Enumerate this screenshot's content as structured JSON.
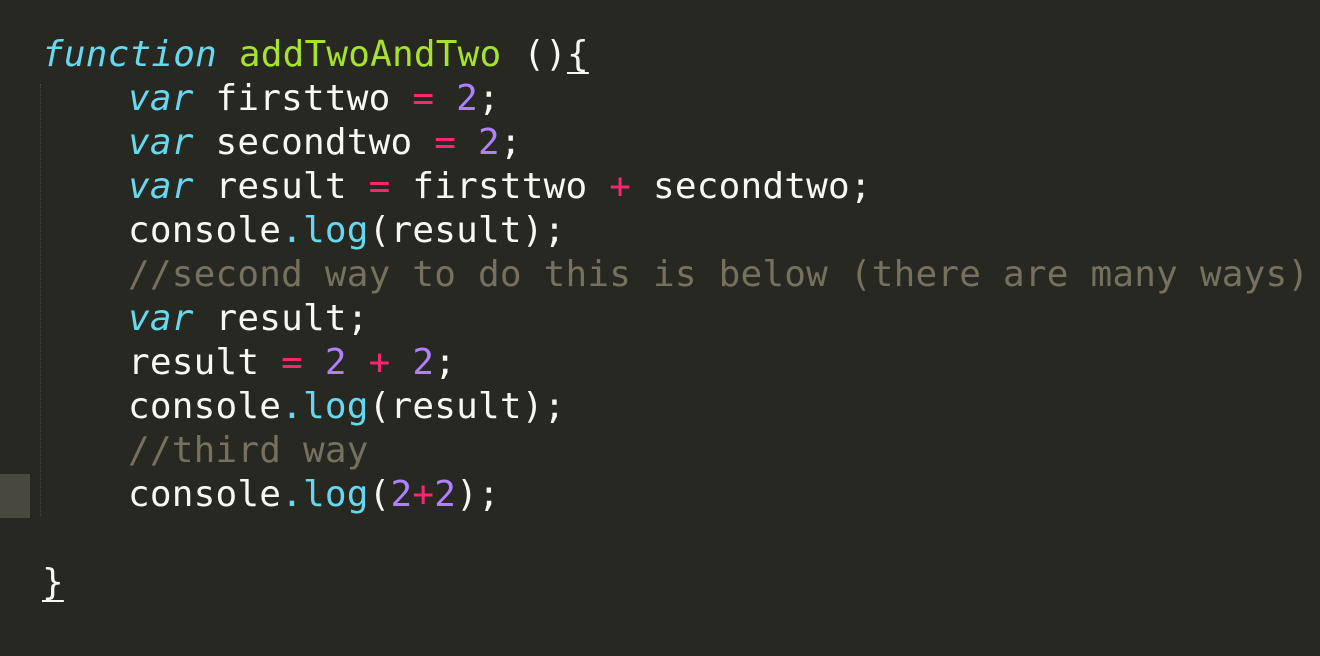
{
  "code": {
    "l1": {
      "keyword": "function",
      "name": "addTwoAndTwo",
      "paren": "()",
      "brace": "{"
    },
    "l2": {
      "kw": "var",
      "ident": "firsttwo",
      "op": "=",
      "num": "2",
      "end": ";"
    },
    "l3": {
      "kw": "var",
      "ident": "secondtwo",
      "op": "=",
      "num": "2",
      "end": ";"
    },
    "l4": {
      "kw": "var",
      "ident": "result",
      "op": "=",
      "a": "firsttwo",
      "plus": "+",
      "b": "secondtwo;"
    },
    "l5": {
      "obj": "console",
      "dot": ".",
      "method": "log",
      "args": "(result);"
    },
    "l6": {
      "comment": "//second way to do this is below (there are many ways)"
    },
    "l7": {
      "kw": "var",
      "rest": "result;"
    },
    "l8": {
      "ident": "result",
      "op": "=",
      "n1": "2",
      "plus": "+",
      "n2": "2",
      "end": ";"
    },
    "l9": {
      "obj": "console",
      "dot": ".",
      "method": "log",
      "args": "(result);"
    },
    "l10": {
      "comment": "//third way"
    },
    "l11": {
      "obj": "console",
      "dot": ".",
      "method": "log",
      "open": "(",
      "n1": "2",
      "plus": "+",
      "n2": "2",
      "close": ");"
    },
    "l13": {
      "brace": "}"
    }
  }
}
